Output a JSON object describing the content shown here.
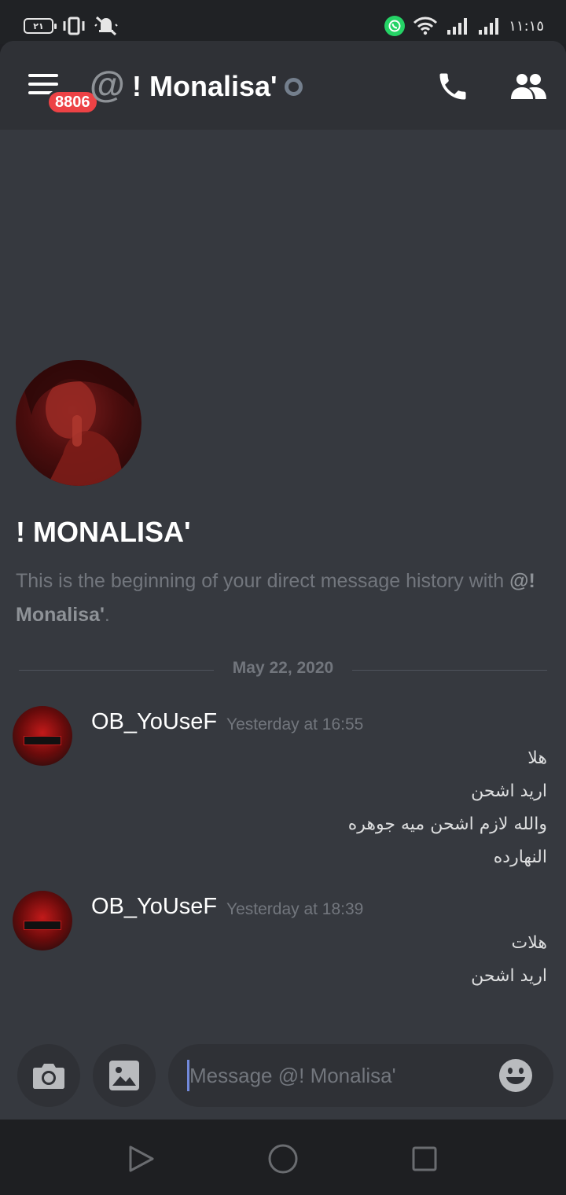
{
  "statusbar": {
    "battery": "٢١",
    "time": "١١:١٥"
  },
  "header": {
    "title": "! Monalisa'",
    "unread_badge": "8806",
    "at_symbol": "@"
  },
  "intro": {
    "name": "! MONALISA'",
    "text_prefix": "This is the beginning of your direct message history with",
    "mention": "@! Monalisa'",
    "text_suffix": "."
  },
  "divider": {
    "date": "May 22, 2020"
  },
  "messages": [
    {
      "author": "OB_YoUseF",
      "time": "Yesterday at 16:55",
      "lines": [
        "هلا",
        "اريد اشحن",
        "والله لازم اشحن ميه جوهره",
        "النهارده"
      ]
    },
    {
      "author": "OB_YoUseF",
      "time": "Yesterday at 18:39",
      "lines": [
        "هلات",
        "اريد اشحن"
      ]
    }
  ],
  "composer": {
    "placeholder": "Message @! Monalisa'"
  },
  "colors": {
    "background": "#36393f",
    "header": "#2f3136",
    "badge": "#ed4245",
    "muted_text": "#72767d",
    "whatsapp": "#25d366"
  },
  "icons": {
    "menu": "hamburger-menu-icon",
    "call": "phone-icon",
    "members": "people-icon",
    "camera": "camera-icon",
    "gallery": "image-icon",
    "emoji": "smiley-icon",
    "nav_back": "triangle-back-icon",
    "nav_home": "circle-home-icon",
    "nav_recent": "square-recents-icon"
  }
}
